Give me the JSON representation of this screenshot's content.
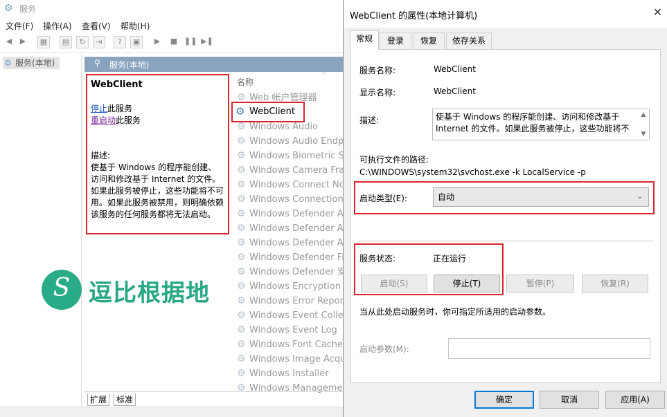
{
  "bg_window": {
    "title": "服务",
    "menu": [
      "文件(F)",
      "操作(A)",
      "查看(V)",
      "帮助(H)"
    ],
    "tree_node": "服务(本地)",
    "header": "服务(本地)",
    "detail": {
      "service_name": "WebClient",
      "stop_link": "停止",
      "stop_suffix": "此服务",
      "restart_link": "重启动",
      "restart_suffix": "此服务",
      "desc_label": "描述:",
      "desc_text": "使基于 Windows 的程序能创建、访问和修改基于 Internet 的文件。如果此服务被停止，这些功能将不可用。如果此服务被禁用，则明确依赖该服务的任何服务都将无法启动。"
    },
    "list_header": "名称",
    "services": [
      "Web 帐户管理器",
      "WebClient",
      "Windows Audio",
      "Windows Audio Endpoi",
      "Windows Biometric Ser",
      "Windows Camera Fram",
      "Windows Connect Now",
      "Windows Connection M",
      "Windows Defender Adv",
      "Windows Defender Anti",
      "Windows Defender Anti",
      "Windows Defender Fire",
      "Windows Defender 安全",
      "Windows Encryption Pro",
      "Windows Error Reportin",
      "Windows Event Collecto",
      "Windows Event Log",
      "Windows Font Cache Se",
      "Windows Image Acquis",
      "Windows Installer",
      "Windows Management"
    ],
    "tabs": [
      "扩展",
      "标准"
    ]
  },
  "watermark": {
    "logo_glyph": "S",
    "text": "逗比根据地",
    "color": "#27a786"
  },
  "dialog": {
    "title": "WebClient 的属性(本地计算机)",
    "close": "✕",
    "tabs": [
      "常规",
      "登录",
      "恢复",
      "依存关系"
    ],
    "service_name_label": "服务名称:",
    "service_name": "WebClient",
    "display_name_label": "显示名称:",
    "display_name": "WebClient",
    "desc_label": "描述:",
    "desc_text": "使基于 Windows 的程序能创建、访问和修改基于 Internet 的文件。如果此服务被停止，这些功能将不",
    "path_label": "可执行文件的路径:",
    "path": "C:\\WINDOWS\\system32\\svchost.exe -k LocalService -p",
    "startup_label": "启动类型(E):",
    "startup_value": "自动",
    "status_label": "服务状态:",
    "status_value": "正在运行",
    "btn_start": "启动(S)",
    "btn_stop": "停止(T)",
    "btn_pause": "暂停(P)",
    "btn_resume": "恢复(R)",
    "hint": "当从此处启动服务时，你可指定所适用的启动参数。",
    "param_label": "启动参数(M):",
    "ok": "确定",
    "cancel": "取消",
    "apply": "应用(A)"
  },
  "colors": {
    "highlight_border": "#d9252c",
    "header_bg": "#8aa4c0",
    "link": "#1a55c0"
  }
}
